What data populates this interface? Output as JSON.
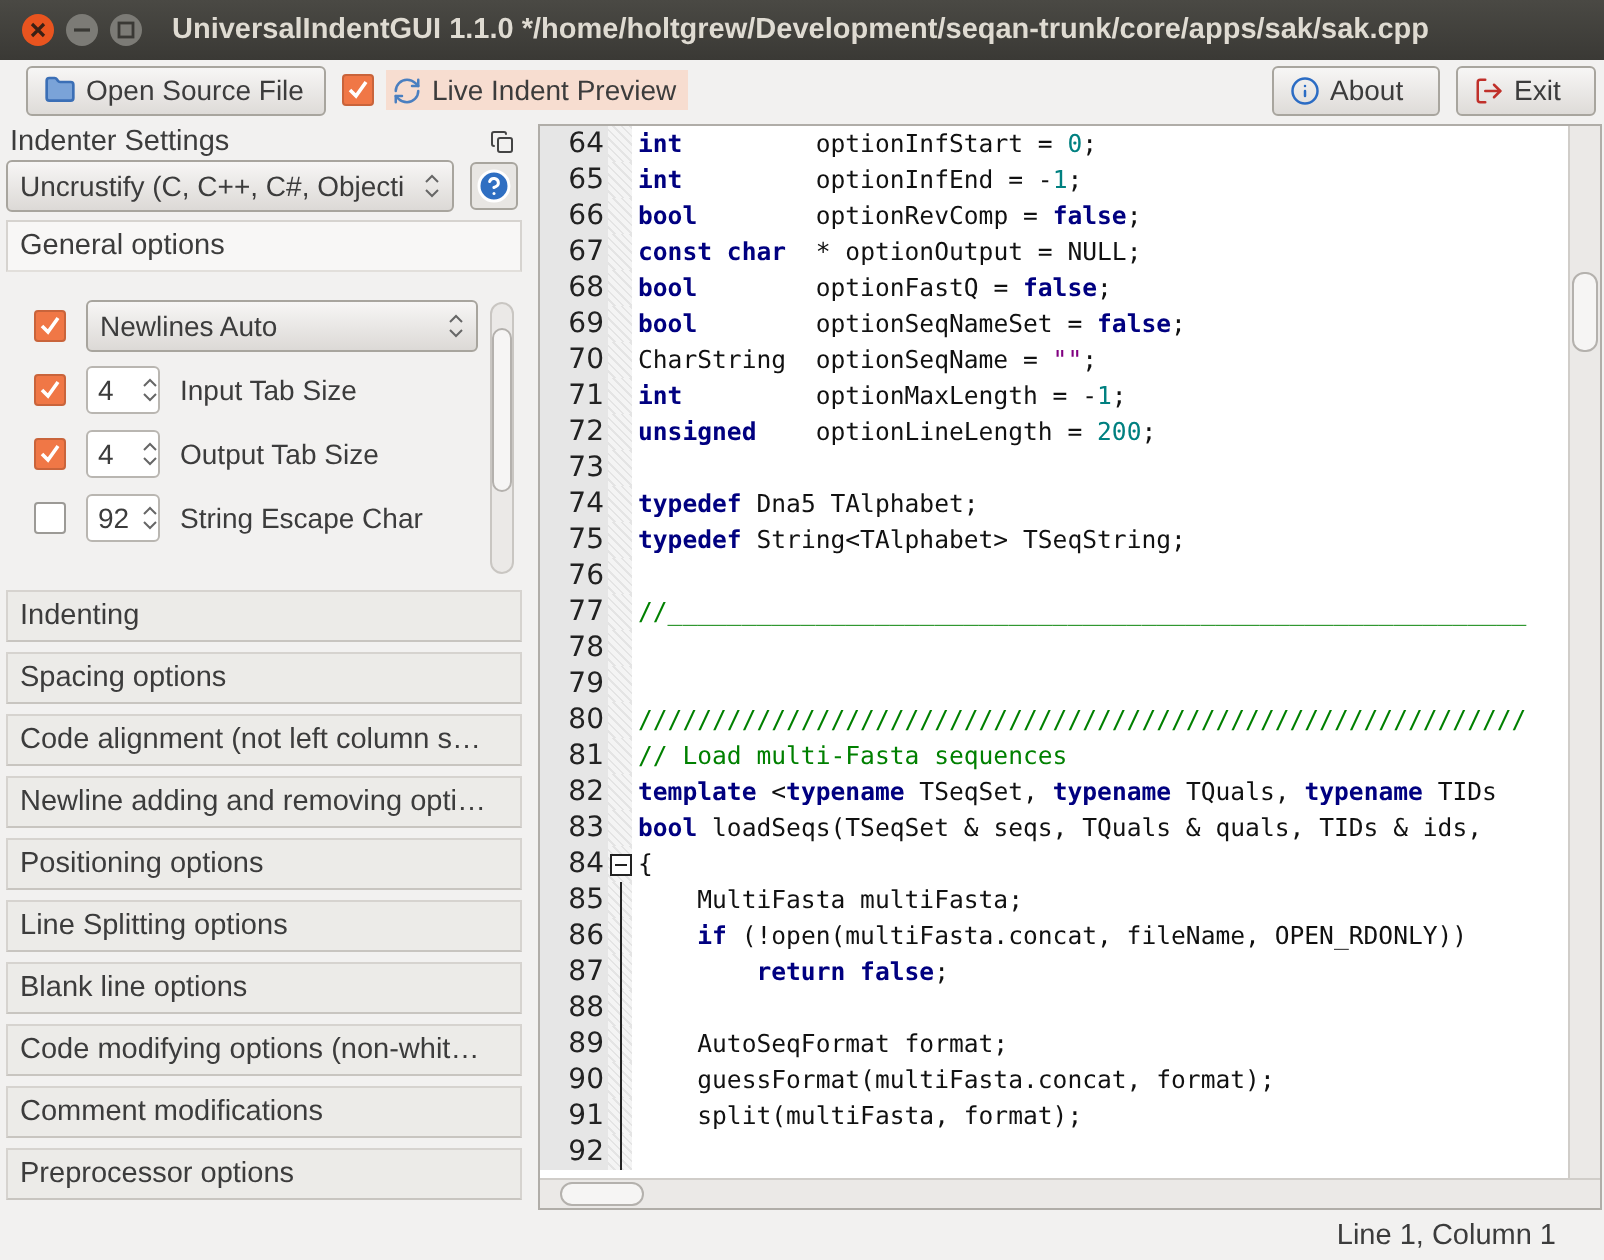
{
  "window": {
    "title": "UniversalIndentGUI 1.1.0 */home/holtgrew/Development/seqan-trunk/core/apps/sak/sak.cpp"
  },
  "toolbar": {
    "open_button": "Open Source File",
    "live_preview": {
      "label": "Live Indent Preview",
      "checked": true
    },
    "about_button": "About",
    "exit_button": "Exit"
  },
  "indenter_panel": {
    "title": "Indenter Settings",
    "indenter": "Uncrustify (C, C++, C#, Objecti",
    "general_options": [
      {
        "kind": "combo",
        "checked": true,
        "value": "Newlines Auto"
      },
      {
        "kind": "spin",
        "checked": true,
        "value": "4",
        "label": "Input Tab Size"
      },
      {
        "kind": "spin",
        "checked": true,
        "value": "4",
        "label": "Output Tab Size"
      },
      {
        "kind": "spin",
        "checked": false,
        "value": "92",
        "label": "String Escape Char"
      }
    ],
    "sections": [
      {
        "label": "General options",
        "expanded": true
      },
      {
        "label": "Indenting",
        "expanded": false
      },
      {
        "label": "Spacing options",
        "expanded": false
      },
      {
        "label": "Code alignment (not left column s…",
        "expanded": false
      },
      {
        "label": "Newline adding and removing opti…",
        "expanded": false
      },
      {
        "label": "Positioning options",
        "expanded": false
      },
      {
        "label": "Line Splitting options",
        "expanded": false
      },
      {
        "label": "Blank line options",
        "expanded": false
      },
      {
        "label": "Code modifying options (non-whit…",
        "expanded": false
      },
      {
        "label": "Comment modifications",
        "expanded": false
      },
      {
        "label": "Preprocessor options",
        "expanded": false
      }
    ]
  },
  "editor": {
    "lines": [
      {
        "number": "64",
        "tokens": [
          {
            "kind": "kw",
            "text": "int"
          },
          {
            "kind": "plain",
            "text": "         optionInfStart = "
          },
          {
            "kind": "num",
            "text": "0"
          },
          {
            "kind": "plain",
            "text": ";"
          }
        ]
      },
      {
        "number": "65",
        "tokens": [
          {
            "kind": "kw",
            "text": "int"
          },
          {
            "kind": "plain",
            "text": "         optionInfEnd = -"
          },
          {
            "kind": "num",
            "text": "1"
          },
          {
            "kind": "plain",
            "text": ";"
          }
        ]
      },
      {
        "number": "66",
        "tokens": [
          {
            "kind": "kw",
            "text": "bool"
          },
          {
            "kind": "plain",
            "text": "        optionRevComp = "
          },
          {
            "kind": "kw",
            "text": "false"
          },
          {
            "kind": "plain",
            "text": ";"
          }
        ]
      },
      {
        "number": "67",
        "tokens": [
          {
            "kind": "kw",
            "text": "const char"
          },
          {
            "kind": "plain",
            "text": "  * optionOutput = NULL;"
          }
        ]
      },
      {
        "number": "68",
        "tokens": [
          {
            "kind": "kw",
            "text": "bool"
          },
          {
            "kind": "plain",
            "text": "        optionFastQ = "
          },
          {
            "kind": "kw",
            "text": "false"
          },
          {
            "kind": "plain",
            "text": ";"
          }
        ]
      },
      {
        "number": "69",
        "tokens": [
          {
            "kind": "kw",
            "text": "bool"
          },
          {
            "kind": "plain",
            "text": "        optionSeqNameSet = "
          },
          {
            "kind": "kw",
            "text": "false"
          },
          {
            "kind": "plain",
            "text": ";"
          }
        ]
      },
      {
        "number": "70",
        "tokens": [
          {
            "kind": "plain",
            "text": "CharString  optionSeqName = "
          },
          {
            "kind": "str",
            "text": "\"\""
          },
          {
            "kind": "plain",
            "text": ";"
          }
        ]
      },
      {
        "number": "71",
        "tokens": [
          {
            "kind": "kw",
            "text": "int"
          },
          {
            "kind": "plain",
            "text": "         optionMaxLength = -"
          },
          {
            "kind": "num",
            "text": "1"
          },
          {
            "kind": "plain",
            "text": ";"
          }
        ]
      },
      {
        "number": "72",
        "tokens": [
          {
            "kind": "kw",
            "text": "unsigned"
          },
          {
            "kind": "plain",
            "text": "    optionLineLength = "
          },
          {
            "kind": "num",
            "text": "200"
          },
          {
            "kind": "plain",
            "text": ";"
          }
        ]
      },
      {
        "number": "73"
      },
      {
        "number": "74",
        "tokens": [
          {
            "kind": "kw",
            "text": "typedef"
          },
          {
            "kind": "plain",
            "text": " Dna5 TAlphabet;"
          }
        ]
      },
      {
        "number": "75",
        "tokens": [
          {
            "kind": "kw",
            "text": "typedef"
          },
          {
            "kind": "plain",
            "text": " String<TAlphabet> TSeqString;"
          }
        ]
      },
      {
        "number": "76"
      },
      {
        "number": "77",
        "tokens": [
          {
            "kind": "comment",
            "text": "//__________________________________________________________"
          }
        ]
      },
      {
        "number": "78"
      },
      {
        "number": "79"
      },
      {
        "number": "80",
        "tokens": [
          {
            "kind": "comment",
            "text": "////////////////////////////////////////////////////////////"
          }
        ]
      },
      {
        "number": "81",
        "tokens": [
          {
            "kind": "comment",
            "text": "// Load multi-Fasta sequences"
          }
        ]
      },
      {
        "number": "82",
        "tokens": [
          {
            "kind": "kw",
            "text": "template"
          },
          {
            "kind": "plain",
            "text": " <"
          },
          {
            "kind": "kw",
            "text": "typename"
          },
          {
            "kind": "plain",
            "text": " TSeqSet, "
          },
          {
            "kind": "kw",
            "text": "typename"
          },
          {
            "kind": "plain",
            "text": " TQuals, "
          },
          {
            "kind": "kw",
            "text": "typename"
          },
          {
            "kind": "plain",
            "text": " TIDs"
          }
        ]
      },
      {
        "number": "83",
        "tokens": [
          {
            "kind": "kw",
            "text": "bool"
          },
          {
            "kind": "plain",
            "text": " loadSeqs(TSeqSet & seqs, TQuals & quals, TIDs & ids,"
          }
        ]
      },
      {
        "number": "84",
        "fold_marker": {
          "expanded": true
        },
        "tokens": [
          {
            "kind": "plain",
            "text": "{"
          }
        ]
      },
      {
        "number": "85",
        "in_fold": true,
        "tokens": [
          {
            "kind": "plain",
            "text": "    MultiFasta multiFasta;"
          }
        ]
      },
      {
        "number": "86",
        "in_fold": true,
        "tokens": [
          {
            "kind": "kw",
            "text": "    if"
          },
          {
            "kind": "plain",
            "text": " (!open(multiFasta.concat, fileName, OPEN_RDONLY))"
          }
        ]
      },
      {
        "number": "87",
        "in_fold": true,
        "tokens": [
          {
            "kind": "kw",
            "text": "        return false"
          },
          {
            "kind": "plain",
            "text": ";"
          }
        ]
      },
      {
        "number": "88",
        "in_fold": true
      },
      {
        "number": "89",
        "in_fold": true,
        "tokens": [
          {
            "kind": "plain",
            "text": "    AutoSeqFormat format;"
          }
        ]
      },
      {
        "number": "90",
        "in_fold": true,
        "tokens": [
          {
            "kind": "plain",
            "text": "    guessFormat(multiFasta.concat, format);"
          }
        ]
      },
      {
        "number": "91",
        "in_fold": true,
        "tokens": [
          {
            "kind": "plain",
            "text": "    split(multiFasta, format);"
          }
        ]
      },
      {
        "number": "92",
        "in_fold": true
      }
    ]
  },
  "status_bar": {
    "position": "Line 1, Column 1"
  }
}
